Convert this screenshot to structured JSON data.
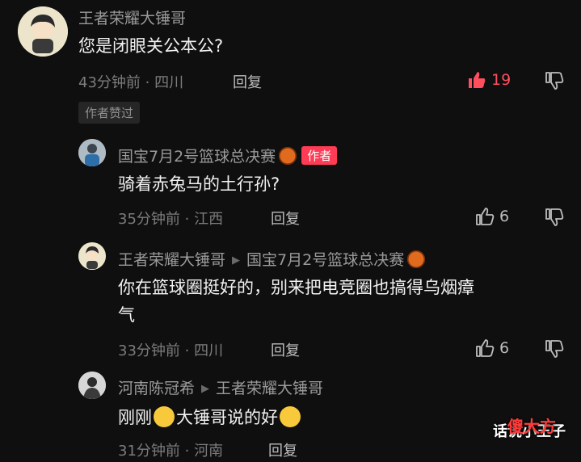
{
  "comments": [
    {
      "author": "王者荣耀大锤哥",
      "text": "您是闭眼关公本公?",
      "meta": "43分钟前 · 四川",
      "reply_label": "回复",
      "likes": "19",
      "author_liked_badge": "作者赞过"
    },
    {
      "author": "国宝7月2号篮球总决赛",
      "author_tag": "作者",
      "text": "骑着赤兔马的土行孙?",
      "meta": "35分钟前 · 江西",
      "reply_label": "回复",
      "likes": "6"
    },
    {
      "author": "王者荣耀大锤哥",
      "reply_to": "国宝7月2号篮球总决赛",
      "text_line1": "你在篮球圈挺好的，别来把电竞圈也搞得乌烟瘴",
      "text_line2": "气",
      "meta": "33分钟前 · 四川",
      "reply_label": "回复",
      "likes": "6"
    },
    {
      "author": "河南陈冠希",
      "reply_to": "王者荣耀大锤哥",
      "text_part1": "刚刚",
      "text_part2": "大锤哥说的好",
      "meta": "31分钟前 · 河南",
      "reply_label": "回复"
    }
  ],
  "watermark": {
    "line1": "话说小王子",
    "line2": "傻大方"
  },
  "colors": {
    "background": "#0f0f0f",
    "like_active": "#ff4f5e",
    "author_tag": "#ff3b55"
  }
}
